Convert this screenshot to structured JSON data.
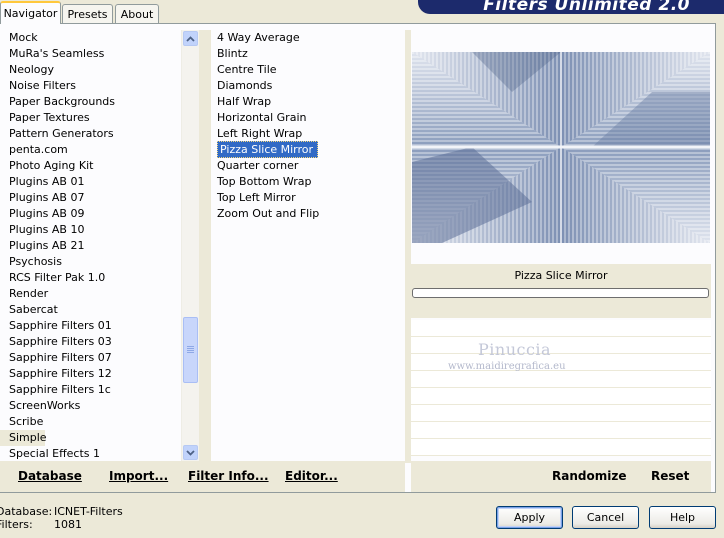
{
  "tabs": [
    "Navigator",
    "Presets",
    "About"
  ],
  "banner_title": "Filters Unlimited 2.0",
  "categories": [
    "Mock",
    "MuRa's Seamless",
    "Neology",
    "Noise Filters",
    "Paper Backgrounds",
    "Paper Textures",
    "Pattern Generators",
    "penta.com",
    "Photo Aging Kit",
    "Plugins AB 01",
    "Plugins AB 07",
    "Plugins AB 09",
    "Plugins AB 10",
    "Plugins AB 21",
    "Psychosis",
    "RCS Filter Pak 1.0",
    "Render",
    "Sabercat",
    "Sapphire Filters 01",
    "Sapphire Filters 03",
    "Sapphire Filters 07",
    "Sapphire Filters 12",
    "Sapphire Filters 1c",
    "ScreenWorks",
    "Scribe",
    "Simple",
    "Special Effects 1"
  ],
  "selected_category": "Simple",
  "filters": [
    "4 Way Average",
    "Blintz",
    "Centre Tile",
    "Diamonds",
    "Half Wrap",
    "Horizontal Grain",
    "Left Right Wrap",
    "Pizza Slice Mirror",
    "Quarter corner",
    "Top Bottom Wrap",
    "Top Left Mirror",
    "Zoom Out and Flip"
  ],
  "selected_filter": "Pizza Slice Mirror",
  "preview": {
    "filter_name": "Pizza Slice Mirror",
    "watermark_name": "Pinuccia",
    "watermark_url": "www.maidiregrafica.eu"
  },
  "actions": {
    "database": "Database",
    "import": "Import...",
    "filter_info": "Filter Info...",
    "editor": "Editor...",
    "randomize": "Randomize",
    "reset": "Reset"
  },
  "status": {
    "database_label": "Database:",
    "database_value": "ICNET-Filters",
    "filters_label": "Filters:",
    "filters_value": "1081"
  },
  "buttons": {
    "apply": "Apply",
    "cancel": "Cancel",
    "help": "Help"
  },
  "colors": {
    "window_bg": "#ece9d8",
    "selection": "#316ac5",
    "banner": "#1c2a6c"
  }
}
